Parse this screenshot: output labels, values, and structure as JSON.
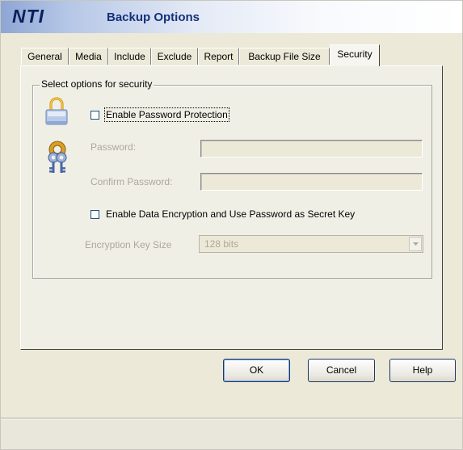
{
  "header": {
    "brand": "NTI",
    "title": "Backup Options"
  },
  "tabs": [
    {
      "label": "General",
      "active": false
    },
    {
      "label": "Media",
      "active": false
    },
    {
      "label": "Include",
      "active": false
    },
    {
      "label": "Exclude",
      "active": false
    },
    {
      "label": "Report",
      "active": false
    },
    {
      "label": "Backup File Size",
      "active": false
    },
    {
      "label": "Security",
      "active": true
    }
  ],
  "security": {
    "group_label": "Select options for security",
    "enable_password": {
      "label": "Enable Password Protection",
      "checked": false
    },
    "password": {
      "label": "Password:",
      "value": "",
      "enabled": false
    },
    "confirm_password": {
      "label": "Confirm Password:",
      "value": "",
      "enabled": false
    },
    "enable_encryption": {
      "label": "Enable Data Encryption and Use Password as Secret Key",
      "checked": false
    },
    "key_size": {
      "label": "Encryption Key Size",
      "value": "128 bits",
      "enabled": false
    }
  },
  "buttons": {
    "ok": "OK",
    "cancel": "Cancel",
    "help": "Help"
  },
  "icons": {
    "lock": "padlock-icon",
    "keys": "keys-icon",
    "dropdown": "chevron-down-icon"
  },
  "colors": {
    "disabled_text": "#aca899",
    "brand": "#0c1f5c",
    "title": "#15317a"
  }
}
